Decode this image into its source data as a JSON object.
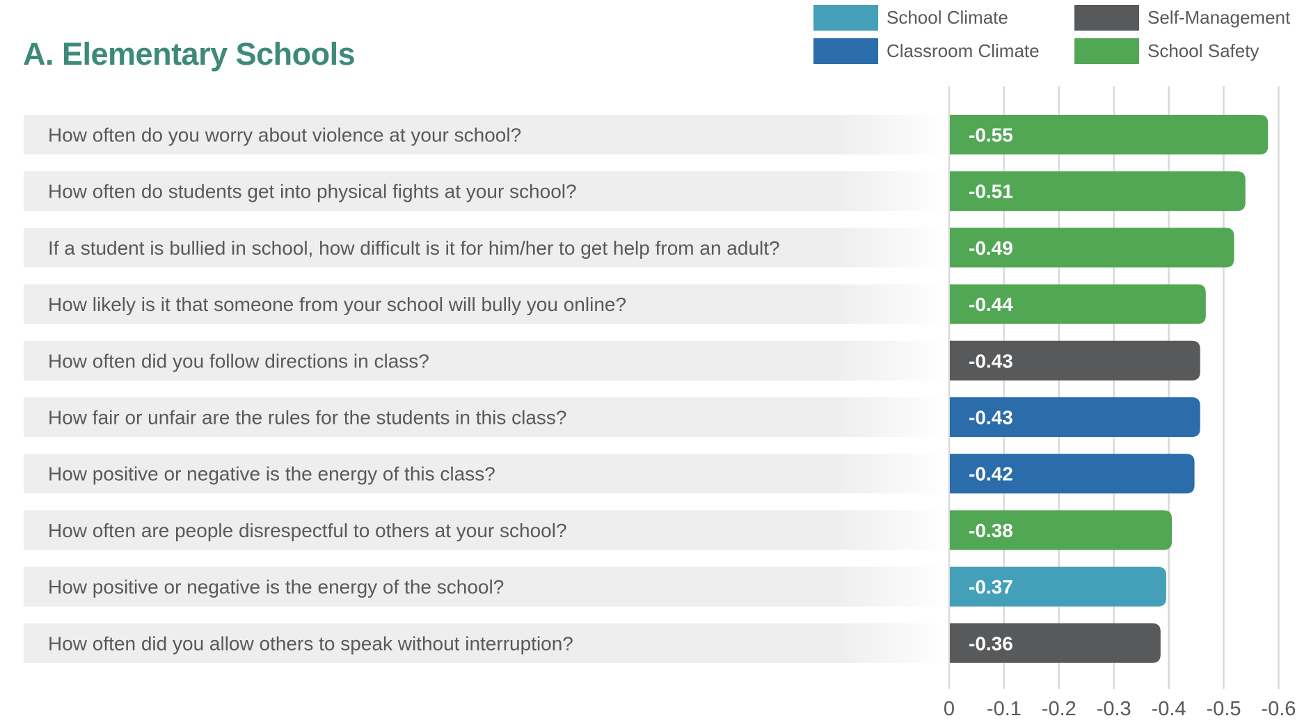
{
  "chart_data": {
    "type": "bar",
    "orientation": "horizontal",
    "title": "A. Elementary Schools",
    "xlabel": "",
    "ylabel": "",
    "xlim": [
      0,
      -0.6
    ],
    "x_ticks": [
      "0",
      "-0.1",
      "-0.2",
      "-0.3",
      "-0.4",
      "-0.5",
      "-0.6"
    ],
    "x_tick_values": [
      0,
      -0.1,
      -0.2,
      -0.3,
      -0.4,
      -0.5,
      -0.6
    ],
    "grid": "vertical",
    "legend_position": "top-right",
    "legend": [
      {
        "name": "School Climate",
        "color": "#44a0b8"
      },
      {
        "name": "Self-Management",
        "color": "#58595b"
      },
      {
        "name": "Classroom Climate",
        "color": "#2b6caa"
      },
      {
        "name": "School Safety",
        "color": "#52a755"
      }
    ],
    "categories": [
      "How often do you worry about violence at your school?",
      "How often do students get into physical fights at your school?",
      "If a student is bullied in school, how difficult is it for him/her to get help from an adult?",
      "How likely is it that someone from your school will bully you online?",
      "How often did you follow directions in class?",
      "How fair or unfair are the rules for the students in this class?",
      "How positive or negative is the energy of this class?",
      "How often are people disrespectful to others at your school?",
      "How positive or negative is the energy of the school?",
      "How often did you allow others to speak without interruption?"
    ],
    "values": [
      -0.55,
      -0.51,
      -0.49,
      -0.44,
      -0.43,
      -0.43,
      -0.42,
      -0.38,
      -0.37,
      -0.36
    ],
    "value_labels": [
      "-0.55",
      "-0.51",
      "-0.49",
      "-0.44",
      "-0.43",
      "-0.43",
      "-0.42",
      "-0.38",
      "-0.37",
      "-0.36"
    ],
    "groups": [
      "School Safety",
      "School Safety",
      "School Safety",
      "School Safety",
      "Self-Management",
      "Classroom Climate",
      "Classroom Climate",
      "School Safety",
      "School Climate",
      "Self-Management"
    ]
  },
  "colors": {
    "title": "#3d8a7a",
    "text": "#58595b",
    "row_background": "#eeeeee",
    "gridline": "#d9d9d9"
  }
}
